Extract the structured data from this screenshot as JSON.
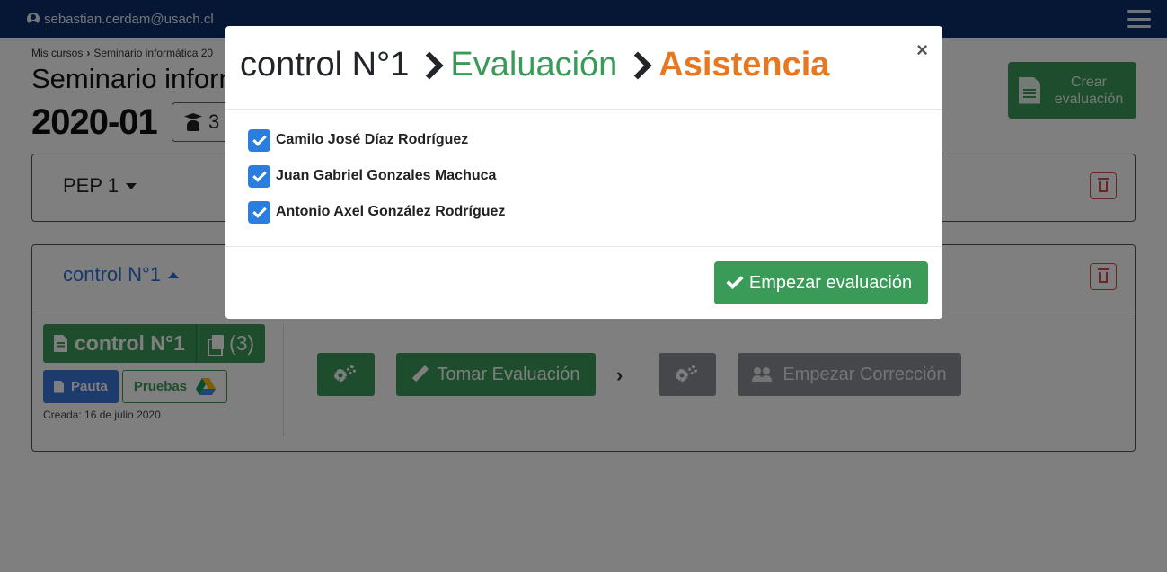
{
  "navbar": {
    "user_email": "sebastian.cerdam@usach.cl"
  },
  "breadcrumb": {
    "items": [
      "Mis cursos",
      "Seminario informática 20"
    ]
  },
  "course": {
    "title": "Seminario informática",
    "term": "2020-01",
    "students_count": "3"
  },
  "actions": {
    "create_evaluation": "Crear evaluación"
  },
  "evaluations": [
    {
      "title": "PEP 1"
    },
    {
      "title": "control N°1",
      "document_label": "control N°1",
      "copies": "(3)",
      "pauta_label": "Pauta",
      "pruebas_label": "Pruebas",
      "created": "Creada: 16 de julio 2020",
      "take_label": "Tomar Evaluación",
      "correction_label": "Empezar Corrección"
    }
  ],
  "modal": {
    "title_parts": [
      "control N°1",
      "Evaluación",
      "Asistencia"
    ],
    "close_label": "×",
    "students": [
      {
        "name": "Camilo José Díaz Rodríguez",
        "checked": true
      },
      {
        "name": "Juan Gabriel Gonzales Machuca",
        "checked": true
      },
      {
        "name": "Antonio Axel González Rodríguez",
        "checked": true
      }
    ],
    "start_button": "Empezar evaluación"
  },
  "colors": {
    "navbar": "#0b2f6b",
    "success": "#3a9b58",
    "primary": "#2b7de0",
    "accent_orange": "#e87722",
    "danger": "#d94848",
    "disabled": "#8a8f96"
  }
}
